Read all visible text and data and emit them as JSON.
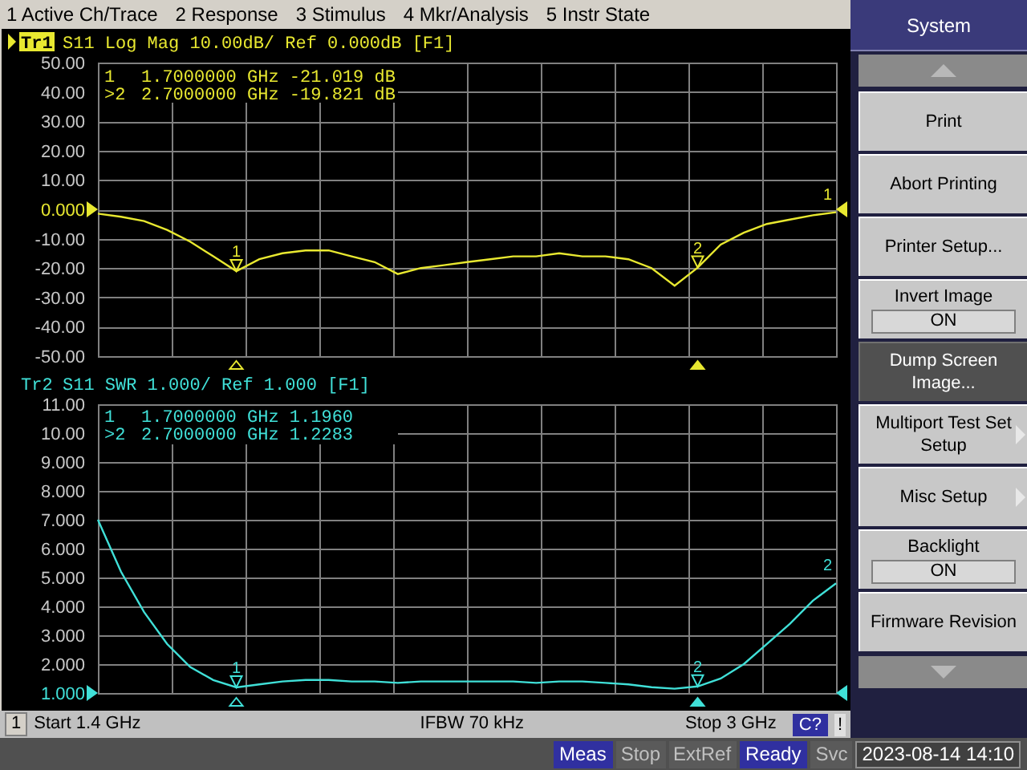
{
  "menu": [
    "1 Active Ch/Trace",
    "2 Response",
    "3 Stimulus",
    "4 Mkr/Analysis",
    "5 Instr State"
  ],
  "traces": [
    {
      "selected": true,
      "id": "Tr1",
      "reference": {
        "level": 0.5
      },
      "title": "S11  Log Mag 10.00dB/ Ref 0.000dB [F1]",
      "readout": [
        {
          "label": "1",
          "text": "1.7000000 GHz -21.019 dB",
          "selected": false
        },
        {
          "label": ">2",
          "text": "2.7000000 GHz -19.821 dB",
          "selected": true
        }
      ],
      "chart_data": {
        "type": "line",
        "ylim": [
          -50,
          50
        ],
        "categories": [
          null,
          null,
          null,
          null,
          null,
          null,
          null,
          null,
          null,
          null,
          null,
          null,
          null,
          null,
          null,
          null,
          null,
          null,
          null,
          null,
          null,
          null,
          null,
          null,
          null,
          null,
          null,
          null,
          null,
          null,
          null,
          null,
          null
        ],
        "yticks": [
          {
            "value": 50,
            "label": "50.00"
          },
          {
            "value": 40,
            "label": "40.00"
          },
          {
            "value": 30,
            "label": "30.00"
          },
          {
            "value": 20,
            "label": "20.00"
          },
          {
            "value": 10,
            "label": "10.00"
          },
          {
            "value": 0,
            "label": "0.000"
          },
          {
            "value": -10,
            "label": "-10.00"
          },
          {
            "value": -20,
            "label": "-20.00"
          },
          {
            "value": -30,
            "label": "-30.00"
          },
          {
            "value": -40,
            "label": "-40.00"
          },
          {
            "value": -50,
            "label": "-50.00"
          }
        ],
        "series": [
          {
            "color": "#e8e830",
            "values": [
              -1.5,
              -2.5,
              -4,
              -7,
              -11,
              -16,
              -21.019,
              -17,
              -15,
              -14,
              -14,
              -16,
              -18,
              -22,
              -20,
              -19,
              -18,
              -17,
              -16,
              -16,
              -15,
              -16,
              -16,
              -17,
              -20,
              -26,
              -19.821,
              -12,
              -8,
              -5,
              -3.5,
              -2,
              -1
            ]
          }
        ],
        "grid": true,
        "annotations": [
          {
            "y": -21.019,
            "text": "1"
          },
          {
            "y": -19.821,
            "text": "2"
          },
          {
            "y": -1,
            "text": "1"
          }
        ]
      }
    },
    {
      "selected": false,
      "id": "Tr2",
      "reference": {
        "level": 0
      },
      "title": "S11  SWR 1.000/ Ref 1.000 [F1]",
      "readout": [
        {
          "label": "1",
          "text": "1.7000000 GHz  1.1960",
          "selected": false
        },
        {
          "label": ">2",
          "text": "2.7000000 GHz  1.2283",
          "selected": true
        }
      ],
      "chart_data": {
        "type": "line",
        "ylim": [
          1,
          11
        ],
        "categories": [
          null,
          null,
          null,
          null,
          null,
          null,
          null,
          null,
          null,
          null,
          null,
          null,
          null,
          null,
          null,
          null,
          null,
          null,
          null,
          null,
          null,
          null,
          null,
          null,
          null,
          null,
          null,
          null,
          null,
          null,
          null,
          null,
          null
        ],
        "yticks": [
          {
            "value": 11,
            "label": "11.00"
          },
          {
            "value": 10,
            "label": "10.00"
          },
          {
            "value": 9,
            "label": "9.000"
          },
          {
            "value": 8,
            "label": "8.000"
          },
          {
            "value": 7,
            "label": "7.000"
          },
          {
            "value": 6,
            "label": "6.000"
          },
          {
            "value": 5,
            "label": "5.000"
          },
          {
            "value": 4,
            "label": "4.000"
          },
          {
            "value": 3,
            "label": "3.000"
          },
          {
            "value": 2,
            "label": "2.000"
          },
          {
            "value": 1,
            "label": "1.000"
          }
        ],
        "series": [
          {
            "color": "#40e0d8",
            "values": [
              7.0,
              5.2,
              3.8,
              2.7,
              1.9,
              1.45,
              1.196,
              1.3,
              1.4,
              1.45,
              1.45,
              1.4,
              1.4,
              1.35,
              1.4,
              1.4,
              1.4,
              1.4,
              1.4,
              1.35,
              1.4,
              1.4,
              1.35,
              1.3,
              1.2,
              1.15,
              1.228,
              1.5,
              2.0,
              2.7,
              3.4,
              4.2,
              4.8
            ]
          }
        ],
        "grid": true,
        "annotations": [
          {
            "y": 1.196,
            "text": "1"
          },
          {
            "y": 1.228,
            "text": "2"
          },
          {
            "y": 4.8,
            "text": "2"
          }
        ]
      }
    }
  ],
  "status_line": {
    "channel": "1",
    "start": "Start 1.4 GHz",
    "ifbw": "IFBW 70 kHz",
    "stop": "Stop 3 GHz",
    "cal": "C?",
    "alert": "!"
  },
  "indicators": [
    {
      "text": "Meas",
      "on": true
    },
    {
      "text": "Stop",
      "on": false
    },
    {
      "text": "ExtRef",
      "on": false
    },
    {
      "text": "Ready",
      "on": true
    },
    {
      "text": "Svc",
      "on": false
    }
  ],
  "datetime": "2023-08-14 14:10",
  "softkeys": [
    {
      "kind": "header",
      "label": "System"
    },
    {
      "kind": "scroll-up"
    },
    {
      "kind": "button",
      "label": "Print",
      "selected": false
    },
    {
      "kind": "button",
      "label": "Abort Printing",
      "selected": false
    },
    {
      "kind": "button",
      "label": "Printer Setup...",
      "selected": false
    },
    {
      "kind": "toggle",
      "label": "Invert Image",
      "value": "ON",
      "selected": false
    },
    {
      "kind": "button",
      "label": "Dump Screen Image...",
      "selected": true
    },
    {
      "kind": "submenu",
      "label": "Multiport Test Set Setup",
      "selected": false
    },
    {
      "kind": "submenu",
      "label": "Misc Setup",
      "selected": false
    },
    {
      "kind": "toggle",
      "label": "Backlight",
      "value": "ON",
      "selected": false
    },
    {
      "kind": "button",
      "label": "Firmware Revision",
      "selected": false
    },
    {
      "kind": "scroll-down"
    }
  ]
}
